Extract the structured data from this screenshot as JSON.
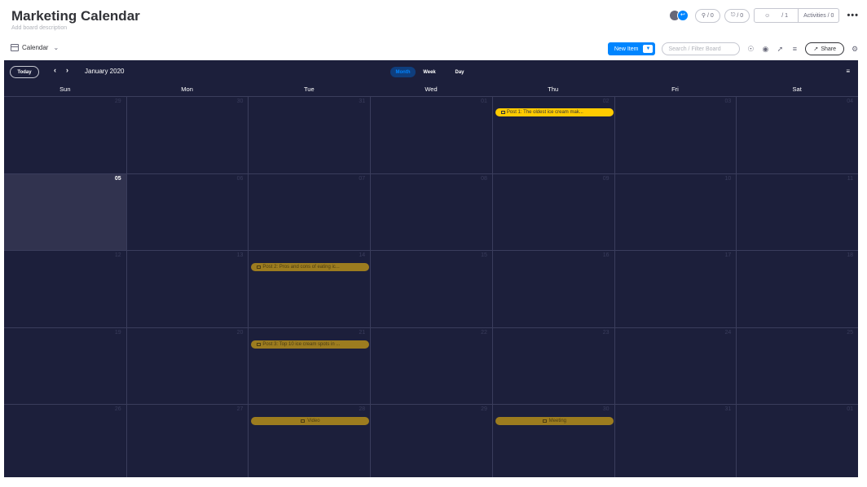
{
  "board": {
    "title": "Marketing Calendar",
    "description": "Add board description",
    "view_label": "Calendar"
  },
  "top_actions": {
    "updates_count": "/ 0",
    "integrations_count": "/ 0",
    "members_count": "/ 1",
    "activities_label": "Activities / 0",
    "more_label": "•••"
  },
  "toolbar": {
    "new_item_label": "New Item",
    "search_placeholder": "Search / Filter Board",
    "share_label": "Share"
  },
  "calendar": {
    "today_label": "Today",
    "prev_label": "‹",
    "next_label": "›",
    "month_title": "January 2020",
    "modes": {
      "month": "Month",
      "week": "Week",
      "day": "Day"
    },
    "weekdays": [
      "Sun",
      "Mon",
      "Tue",
      "Wed",
      "Thu",
      "Fri",
      "Sat"
    ],
    "weeks": [
      [
        "29",
        "30",
        "31",
        "01",
        "02",
        "03",
        "04"
      ],
      [
        "05",
        "06",
        "07",
        "08",
        "09",
        "10",
        "11"
      ],
      [
        "12",
        "13",
        "14",
        "15",
        "16",
        "17",
        "18"
      ],
      [
        "19",
        "20",
        "21",
        "22",
        "23",
        "24",
        "25"
      ],
      [
        "26",
        "27",
        "28",
        "29",
        "30",
        "31",
        "01"
      ]
    ],
    "today_day": "05",
    "events": {
      "post1": "Post 1: The oldest ice cream mak...",
      "post2": "Post 2: Pros and cons of eating ic...",
      "post3": "Post 3: Top 10 ice cream spots in ...",
      "video": "Video",
      "meeting": "Meeting"
    }
  },
  "colors": {
    "accent": "#0085ff",
    "calendar_bg": "#1c1f3b",
    "event_active": "#ffcb00",
    "event_dim": "#9c7c1f"
  }
}
